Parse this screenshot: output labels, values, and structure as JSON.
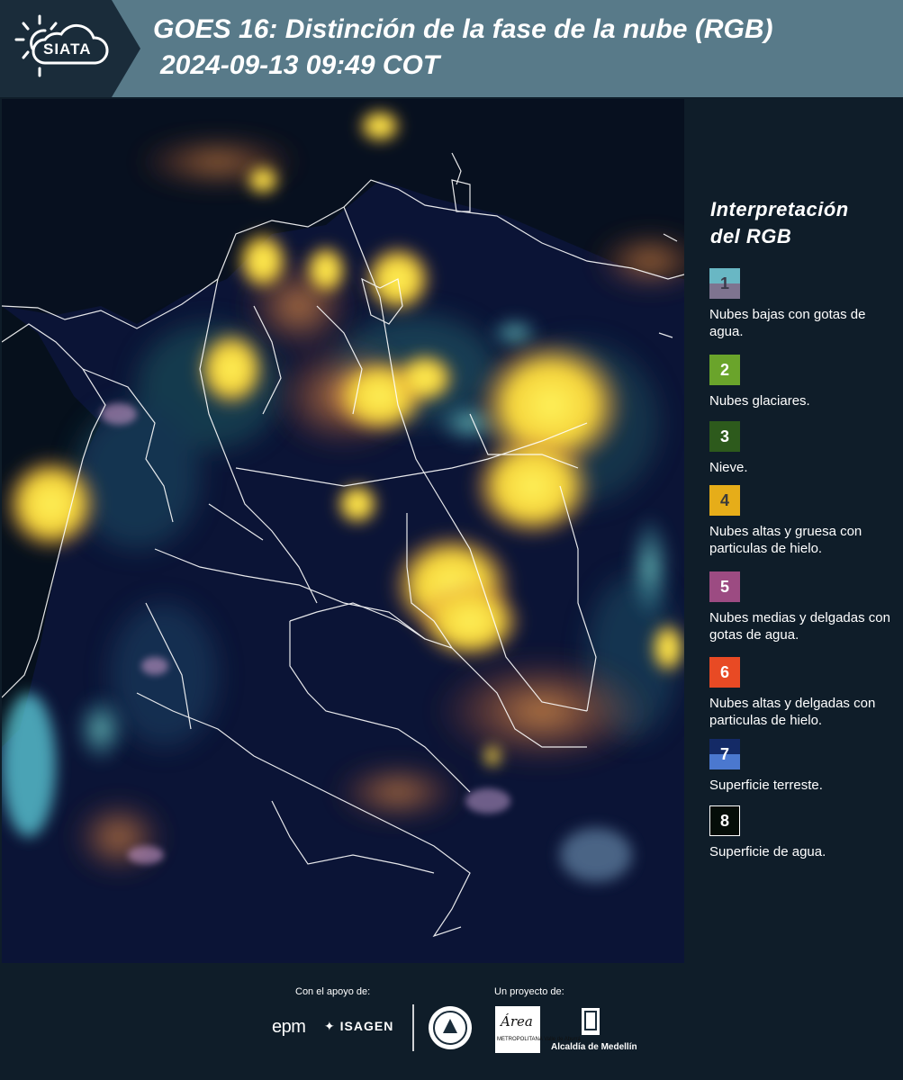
{
  "header": {
    "logo_text": "SIATA",
    "title": "GOES 16: Distinción de la fase de la nube (RGB)",
    "subtitle": "2024-09-13 09:49 COT"
  },
  "legend": {
    "title_line1": "Interpretación",
    "title_line2": "del RGB",
    "items": [
      {
        "number": "1",
        "label": "Nubes bajas con gotas de agua.",
        "color_top": "#69b7c4",
        "color_bottom": "#7e7490",
        "num_color": "#3a3a4a"
      },
      {
        "number": "2",
        "label": "Nubes glaciares.",
        "color": "#6aa42b",
        "num_color": "#ffffff"
      },
      {
        "number": "3",
        "label": "Nieve.",
        "color": "#2d5a1c",
        "num_color": "#ffffff"
      },
      {
        "number": "4",
        "label": "Nubes altas y gruesa con particulas de hielo.",
        "color": "#e6ad19",
        "num_color": "#3a3a3a"
      },
      {
        "number": "5",
        "label": "Nubes medias y delgadas con gotas de agua.",
        "color": "#9c4b82",
        "num_color": "#ffffff"
      },
      {
        "number": "6",
        "label": "Nubes altas y delgadas con particulas de hielo.",
        "color": "#e84a24",
        "num_color": "#ffffff"
      },
      {
        "number": "7",
        "label": "Superficie terreste.",
        "color_top": "#142a66",
        "color_bottom": "#4b78cf",
        "num_color": "#ffffff"
      },
      {
        "number": "8",
        "label": "Superficie de agua.",
        "color": "#050d08",
        "num_color": "#ffffff",
        "border": "#ffffff"
      }
    ]
  },
  "footer": {
    "support_label": "Con el apoyo de:",
    "project_label": "Un proyecto de:",
    "sponsor_1": "epm",
    "sponsor_2": "ISAGEN",
    "partner_area": "Área",
    "partner_area_sub": "METROPOLITANA Valle de Aburrá",
    "partner_alcaldia": "Alcaldía de Medellín"
  },
  "colors": {
    "header_bg": "#587a89",
    "panel_bg": "#0f1d29",
    "map_bg": "#0b1436"
  }
}
